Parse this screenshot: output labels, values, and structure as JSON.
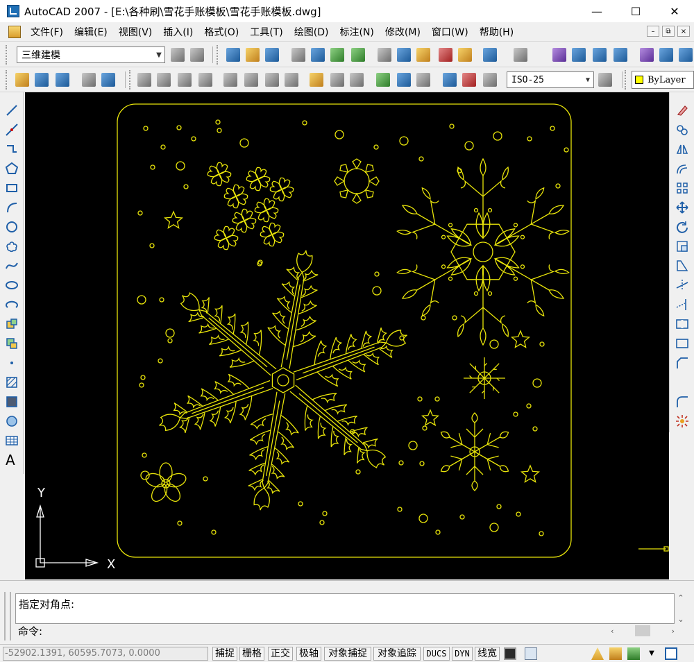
{
  "window": {
    "title": "AutoCAD 2007 - [E:\\各种刷\\雪花手账模板\\雪花手账模板.dwg]",
    "minimize_symbol": "—",
    "maximize_symbol": "☐",
    "close_symbol": "✕"
  },
  "menu": {
    "items": [
      "文件(F)",
      "编辑(E)",
      "视图(V)",
      "插入(I)",
      "格式(O)",
      "工具(T)",
      "绘图(D)",
      "标注(N)",
      "修改(M)",
      "窗口(W)",
      "帮助(H)"
    ],
    "doc_minimize": "–",
    "doc_restore": "⧉",
    "doc_close": "×"
  },
  "toolbar": {
    "workspace": "三维建模",
    "dim_style": "ISO-25",
    "layer": "ByLayer"
  },
  "command": {
    "history": "指定对角点:",
    "prompt": "命令:"
  },
  "status": {
    "coordinates": "-52902.1391, 60595.7073, 0.0000",
    "toggles": [
      "捕捉",
      "栅格",
      "正交",
      "极轴",
      "对象捕捉",
      "对象追踪",
      "DUCS",
      "DYN",
      "线宽"
    ]
  },
  "ucs": {
    "y_label": "Y",
    "x_label": "X"
  },
  "colors": {
    "drawing_line": "#e8e40a",
    "canvas_bg": "#000000"
  },
  "icons": {
    "app": "autocad-icon",
    "left_draw": [
      "line-icon",
      "construction-line-icon",
      "polyline-icon",
      "polygon-icon",
      "rectangle-icon",
      "arc-icon",
      "circle-icon",
      "revision-cloud-icon",
      "spline-icon",
      "ellipse-icon",
      "ellipse-arc-icon",
      "insert-block-icon",
      "make-block-icon",
      "point-icon",
      "hatch-icon",
      "gradient-icon",
      "region-icon",
      "table-icon",
      "multiline-text-icon"
    ],
    "right_modify": [
      "erase-icon",
      "copy-icon",
      "mirror-icon",
      "offset-icon",
      "array-icon",
      "move-icon",
      "rotate-icon",
      "scale-icon",
      "stretch-icon",
      "trim-icon",
      "extend-icon",
      "break-icon",
      "join-icon",
      "chamfer-icon",
      "fillet-icon",
      "explode-icon"
    ]
  }
}
